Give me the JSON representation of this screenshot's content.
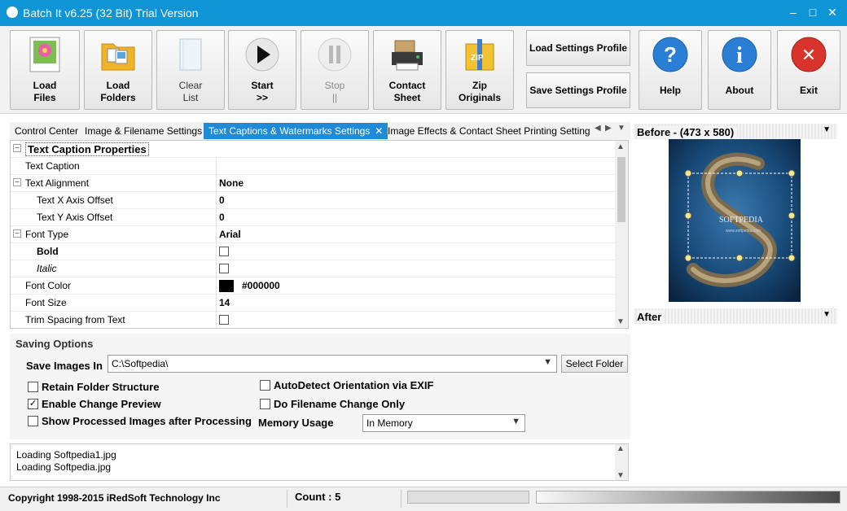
{
  "window": {
    "title": "Batch It v6.25 (32 Bit) Trial Version",
    "minimize_icon": "minimize-icon",
    "maximize_icon": "maximize-icon",
    "close_icon": "close-icon",
    "titlebar_color": "#0f95d6"
  },
  "toolbar": {
    "load_files": {
      "line1": "Load",
      "line2": "Files"
    },
    "load_folders": {
      "line1": "Load",
      "line2": "Folders"
    },
    "clear_list": {
      "line1": "Clear",
      "line2": "List"
    },
    "start": {
      "line1": "Start",
      "line2": ">>"
    },
    "stop": {
      "line1": "Stop",
      "line2": "||"
    },
    "contact_sheet": {
      "line1": "Contact",
      "line2": "Sheet"
    },
    "zip_originals": {
      "line1": "Zip",
      "line2": "Originals",
      "badge": "ZIP"
    },
    "load_settings_profile": "Load Settings Profile",
    "save_settings_profile": "Save Settings Profile",
    "help": {
      "label": "Help",
      "glyph": "?"
    },
    "about": {
      "label": "About",
      "glyph": "i"
    },
    "exit": {
      "label": "Exit",
      "glyph": "✕"
    }
  },
  "tabs": {
    "items": [
      "Control Center",
      "Image & Filename Settings",
      "Text Captions & Watermarks Settings",
      "Image Effects & Contact Sheet Printing Setting"
    ],
    "active_index": 2,
    "active_color": "#1f8ad6"
  },
  "properties": {
    "category_text_caption": "Text Caption Properties",
    "text_caption": {
      "name": "Text Caption",
      "value": ""
    },
    "text_alignment": {
      "name": "Text Alignment",
      "value": "None"
    },
    "text_x_offset": {
      "name": "Text X Axis Offset",
      "value": "0"
    },
    "text_y_offset": {
      "name": "Text Y Axis Offset",
      "value": "0"
    },
    "font_type": {
      "name": "Font Type",
      "value": "Arial"
    },
    "bold": {
      "name": "Bold",
      "checked": false
    },
    "italic": {
      "name": "Italic",
      "checked": false
    },
    "font_color": {
      "name": "Font Color",
      "value": "#000000"
    },
    "font_size": {
      "name": "Font Size",
      "value": "14"
    },
    "trim_spacing": {
      "name": "Trim Spacing from Text",
      "checked": false
    }
  },
  "saving": {
    "title": "Saving Options",
    "save_images_label": "Save Images In",
    "save_path": "C:\\Softpedia\\",
    "select_folder": "Select Folder",
    "retain_folder_structure": {
      "label": "Retain Folder Structure",
      "checked": false
    },
    "enable_change_preview": {
      "label": "Enable Change Preview",
      "checked": true
    },
    "show_processed": {
      "label": "Show Processed Images after Processing",
      "checked": false
    },
    "autodetect_orientation": {
      "label": "AutoDetect Orientation via EXIF",
      "checked": false
    },
    "filename_change_only": {
      "label": "Do Filename Change Only",
      "checked": false
    },
    "memory_usage_label": "Memory Usage",
    "memory_usage_value": "In Memory",
    "check_mark": "✓"
  },
  "log": {
    "lines": [
      "Loading Softpedia1.jpg",
      "Loading Softpedia.jpg"
    ]
  },
  "preview": {
    "before_title": "Before - (473 x 580)",
    "after_title": "After",
    "watermark_text": "SOFTPEDIA",
    "watermark_url": "www.softpedia.com"
  },
  "status": {
    "copyright": "Copyright 1998-2015 iRedSoft Technology Inc",
    "count": "Count : 5"
  }
}
